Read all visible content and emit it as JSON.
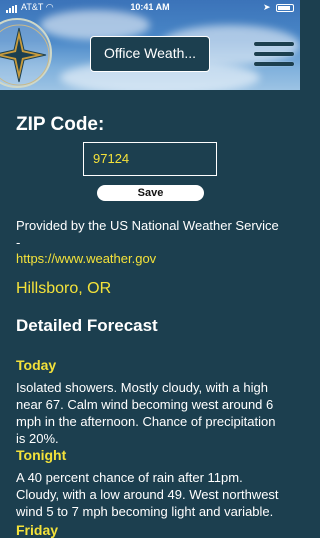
{
  "status_bar": {
    "carrier": "AT&T",
    "time": "10:41 AM"
  },
  "header": {
    "office_button_label": "Office Weath...",
    "logo_icon": "compass-star-icon",
    "menu_icon": "hamburger-menu-icon"
  },
  "zip": {
    "label": "ZIP Code:",
    "value": "97124",
    "save_label": "Save"
  },
  "source": {
    "provided_text": "Provided by the US National Weather Service -",
    "link_text": "https://www.weather.gov"
  },
  "location": "Hillsboro, OR",
  "forecast": {
    "title": "Detailed Forecast",
    "periods": [
      {
        "name": "Today",
        "text": "Isolated showers.  Mostly cloudy, with a high near 67. Calm wind becoming west around 6 mph in the afternoon.  Chance of precipitation is 20%."
      },
      {
        "name": "Tonight",
        "text": "A 40 percent chance of rain after 11pm. Cloudy, with a low around 49. West northwest wind 5 to 7 mph becoming light and variable."
      },
      {
        "name": "Friday",
        "text": ""
      }
    ]
  },
  "colors": {
    "background": "#1c3f4f",
    "accent_yellow": "#f4e23a"
  }
}
